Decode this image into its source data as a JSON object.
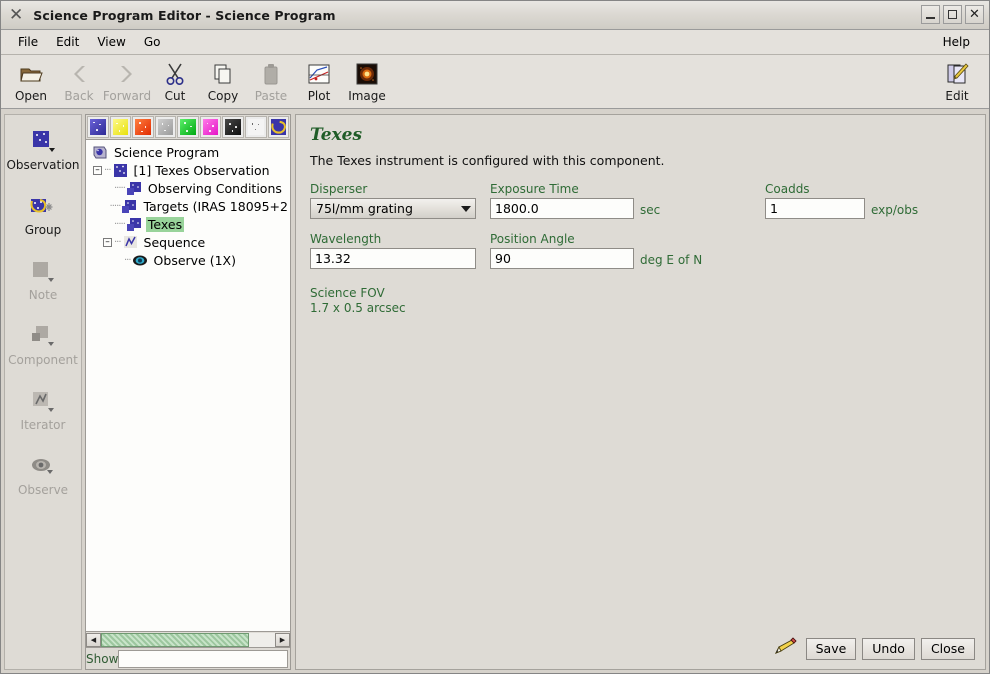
{
  "window": {
    "title": "Science Program Editor - Science Program",
    "app_icon": "x-logo-icon",
    "minimize": "_",
    "maximize": "□",
    "close": "✕"
  },
  "menubar": {
    "items": [
      {
        "label": "File"
      },
      {
        "label": "Edit"
      },
      {
        "label": "View"
      },
      {
        "label": "Go"
      }
    ],
    "right": {
      "label": "Help"
    }
  },
  "toolbar": {
    "buttons": [
      {
        "label": "Open",
        "icon": "open-folder-icon",
        "enabled": true
      },
      {
        "label": "Back",
        "icon": "back-arrow-icon",
        "enabled": false
      },
      {
        "label": "Forward",
        "icon": "forward-arrow-icon",
        "enabled": false
      },
      {
        "label": "Cut",
        "icon": "scissors-icon",
        "enabled": true
      },
      {
        "label": "Copy",
        "icon": "copy-pages-icon",
        "enabled": true
      },
      {
        "label": "Paste",
        "icon": "clipboard-icon",
        "enabled": false
      },
      {
        "label": "Plot",
        "icon": "plot-chart-icon",
        "enabled": true
      },
      {
        "label": "Image",
        "icon": "star-image-icon",
        "enabled": true
      }
    ],
    "edit_button": {
      "label": "Edit",
      "icon": "edit-pencil-icon"
    }
  },
  "rail": {
    "items": [
      {
        "label": "Observation",
        "icon": "observation-icon",
        "enabled": true
      },
      {
        "label": "Group",
        "icon": "group-icon",
        "enabled": true
      },
      {
        "label": "Note",
        "icon": "note-icon",
        "enabled": false
      },
      {
        "label": "Component",
        "icon": "component-icon",
        "enabled": false
      },
      {
        "label": "Iterator",
        "icon": "iterator-icon",
        "enabled": false
      },
      {
        "label": "Observe",
        "icon": "observe-eye-icon",
        "enabled": false
      }
    ]
  },
  "palette": {
    "swatches": [
      {
        "name": "palette-blue",
        "color": "#3a35a8"
      },
      {
        "name": "palette-yellow",
        "color": "#f5ef1d"
      },
      {
        "name": "palette-red",
        "color": "#f43a0a"
      },
      {
        "name": "palette-gray",
        "color": "#a8a8a8"
      },
      {
        "name": "palette-green",
        "color": "#12c421"
      },
      {
        "name": "palette-magenta",
        "color": "#f22ad0"
      },
      {
        "name": "palette-black",
        "color": "#1a1a1a"
      },
      {
        "name": "palette-white",
        "color": "#f2f2f2"
      },
      {
        "name": "palette-group",
        "color": "#3a35a8"
      }
    ]
  },
  "tree": {
    "nodes": [
      {
        "label": "Science Program",
        "depth": 0,
        "icon": "program-icon",
        "expander": "",
        "selected": false
      },
      {
        "label": "[1] Texes Observation",
        "depth": 1,
        "icon": "observation-icon",
        "expander": "–",
        "selected": false
      },
      {
        "label": "Observing Conditions",
        "depth": 2,
        "icon": "component-icon",
        "expander": "",
        "selected": false
      },
      {
        "label": "Targets (IRAS 18095+2",
        "depth": 2,
        "icon": "component-icon",
        "expander": "",
        "selected": false
      },
      {
        "label": "Texes",
        "depth": 2,
        "icon": "component-icon",
        "expander": "",
        "selected": true
      },
      {
        "label": "Sequence",
        "depth": 1,
        "icon": "iterator-icon",
        "expander": "–",
        "selected": false
      },
      {
        "label": "Observe (1X)",
        "depth": 2,
        "icon": "observe-eye-icon",
        "expander": "",
        "selected": false
      }
    ]
  },
  "show": {
    "label": "Show",
    "value": "",
    "placeholder": ""
  },
  "editor": {
    "title": "Texes",
    "description": "The Texes instrument is configured with this component.",
    "fields": {
      "disperser": {
        "label": "Disperser",
        "value": "75l/mm grating",
        "unit": ""
      },
      "exposure_time": {
        "label": "Exposure Time",
        "value": "1800.0",
        "unit": "sec"
      },
      "coadds": {
        "label": "Coadds",
        "value": "1",
        "unit": "exp/obs"
      },
      "wavelength": {
        "label": "Wavelength",
        "value": "13.32",
        "unit": ""
      },
      "position_angle": {
        "label": "Position Angle",
        "value": "90",
        "unit": "deg E of N"
      }
    },
    "science_fov": {
      "label": "Science FOV",
      "value": "1.7 x 0.5 arcsec"
    },
    "buttons": [
      {
        "label": "Save"
      },
      {
        "label": "Undo"
      },
      {
        "label": "Close"
      }
    ],
    "pencil_icon": "pencil-icon"
  },
  "colors": {
    "accent_green": "#2f6b36",
    "title_green": "#1f5c27",
    "selection_green": "#98d39a",
    "panel_bg": "#dedbd5"
  }
}
